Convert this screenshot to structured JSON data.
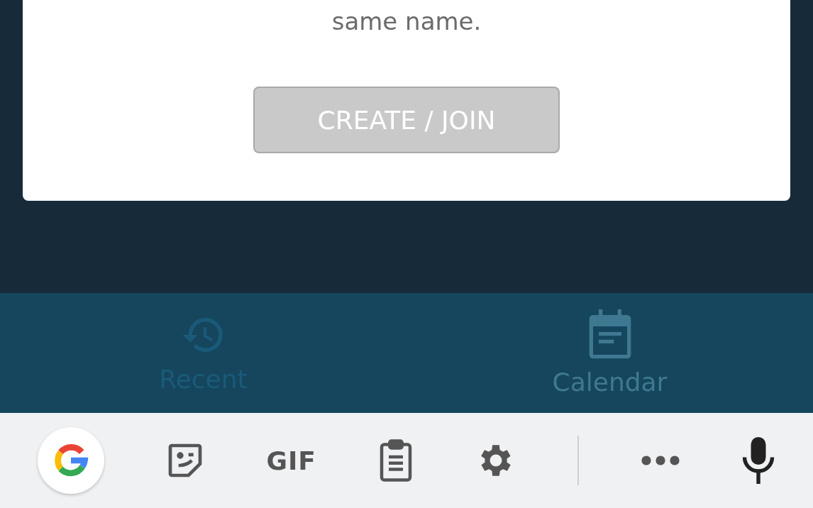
{
  "dialog": {
    "message_tail": "same name.",
    "button": {
      "label": "CREATE / JOIN",
      "disabled": true
    }
  },
  "bottom_nav": [
    {
      "label": "Recent",
      "kind": "history",
      "selected": false
    },
    {
      "label": "Calendar",
      "kind": "calendar",
      "selected": true
    }
  ],
  "keyboard_toolbar": [
    {
      "kind": "g-logo"
    },
    {
      "kind": "sticker"
    },
    {
      "kind": "gif",
      "label": "GIF"
    },
    {
      "kind": "clipboard"
    },
    {
      "kind": "settings"
    },
    {
      "kind": "divider"
    },
    {
      "kind": "more"
    },
    {
      "kind": "mic"
    }
  ]
}
